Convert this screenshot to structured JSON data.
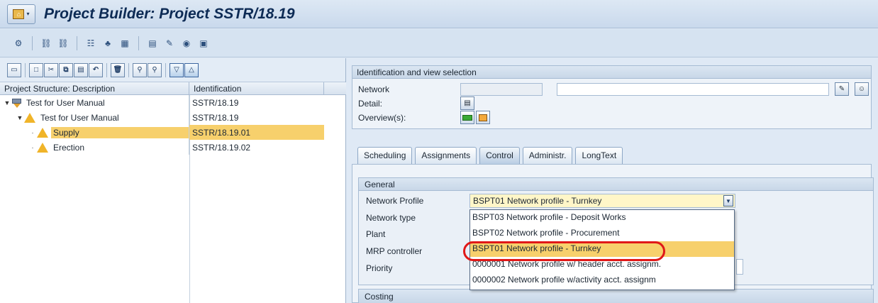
{
  "window": {
    "title": "Project Builder: Project SSTR/18.19"
  },
  "left_pane": {
    "columns": [
      "Project Structure: Description",
      "Identification"
    ],
    "rows": [
      {
        "label": "Test for User Manual",
        "id": "SSTR/18.19"
      },
      {
        "label": "Test for User Manual",
        "id": "SSTR/18.19"
      },
      {
        "label": "Supply",
        "id": "SSTR/18.19.01"
      },
      {
        "label": "Erection",
        "id": "SSTR/18.19.02"
      }
    ]
  },
  "identification": {
    "title": "Identification and view selection",
    "network_label": "Network",
    "detail_label": "Detail:",
    "overview_label": "Overview(s):"
  },
  "tabs": [
    "Scheduling",
    "Assignments",
    "Control",
    "Administr.",
    "LongText"
  ],
  "general": {
    "title": "General",
    "labels": {
      "network_profile": "Network Profile",
      "network_type": "Network type",
      "plant": "Plant",
      "mrp_controller": "MRP controller",
      "priority": "Priority"
    },
    "network_profile_value": "BSPT01 Network profile - Turnkey",
    "options": [
      "BSPT03  Network profile - Deposit Works",
      "BSPT02  Network profile - Procurement",
      "BSPT01  Network profile - Turnkey",
      "0000001 Network profile w/ header acct. assignm.",
      "0000002 Network profile w/activity acct. assignm"
    ]
  },
  "costing": {
    "title": "Costing"
  }
}
